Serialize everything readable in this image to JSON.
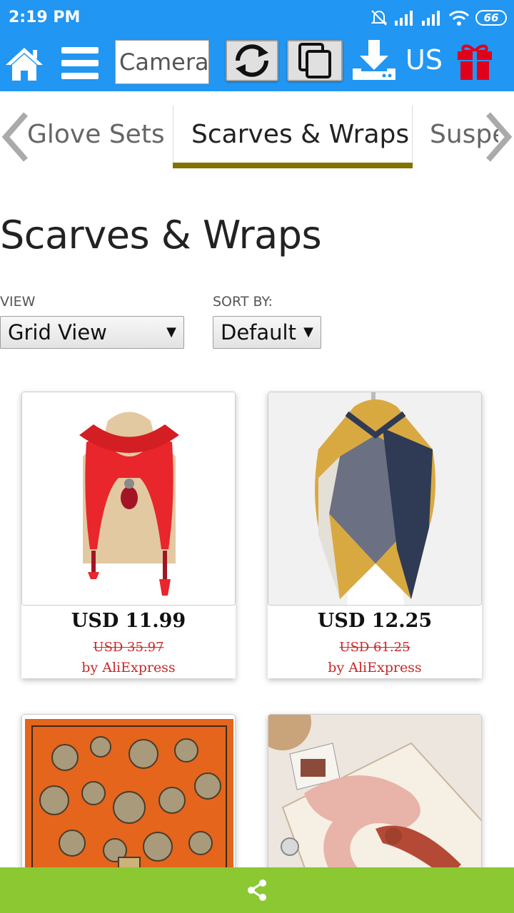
{
  "status_bar": {
    "time": "2:19 PM",
    "battery": "66",
    "icons": [
      "alarm-off-icon",
      "signal-icon",
      "signal-icon",
      "wifi-icon",
      "battery-icon"
    ]
  },
  "toolbar": {
    "camera_label": "Camera",
    "currency": "US",
    "icons": [
      "home-icon",
      "menu-icon",
      "refresh-icon",
      "copy-icon",
      "download-icon",
      "gift-icon"
    ],
    "accent_color": "#2196f3",
    "gift_color": "#e0001b"
  },
  "tabs": {
    "prev": "Glove Sets",
    "active": "Scarves & Wraps",
    "next": "Suspe",
    "active_underline_color": "#827200"
  },
  "page": {
    "title": "Scarves & Wraps"
  },
  "controls": {
    "view_label": "VIEW",
    "view_value": "Grid View",
    "sort_label": "SORT BY:",
    "sort_value": "Default"
  },
  "products": [
    {
      "price": "USD 11.99",
      "old_price": "USD 35.97",
      "seller": "by AliExpress",
      "image": "red-scarf-necklace"
    },
    {
      "price": "USD 12.25",
      "old_price": "USD 61.25",
      "seller": "by AliExpress",
      "image": "plaid-blanket-scarf"
    },
    {
      "image": "orange-silk-scarf"
    },
    {
      "image": "pink-ribbon-scarf"
    }
  ],
  "share_bar": {
    "icon": "share-icon",
    "color": "#8bc832"
  }
}
